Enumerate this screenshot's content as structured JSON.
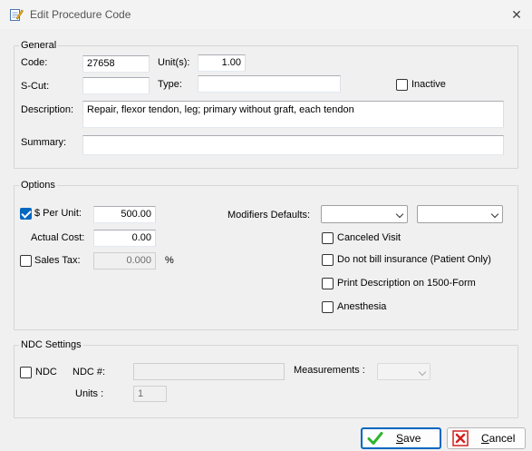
{
  "window": {
    "title": "Edit Procedure Code",
    "close_glyph": "✕",
    "icon": "edit-document-icon"
  },
  "general": {
    "legend": "General",
    "code_label": "Code:",
    "code_value": "27658",
    "units_label": "Unit(s):",
    "units_value": "1.00",
    "scut_label": "S-Cut:",
    "scut_value": "",
    "type_label": "Type:",
    "type_value": "",
    "inactive_label": "Inactive",
    "inactive_checked": false,
    "description_label": "Description:",
    "description_value": "Repair, flexor tendon, leg; primary without graft, each tendon",
    "summary_label": "Summary:",
    "summary_value": ""
  },
  "options": {
    "legend": "Options",
    "per_unit_label": "$ Per Unit:",
    "per_unit_checked": true,
    "per_unit_value": "500.00",
    "actual_cost_label": "Actual Cost:",
    "actual_cost_value": "0.00",
    "sales_tax_label": "Sales Tax:",
    "sales_tax_checked": false,
    "sales_tax_value": "0.000",
    "sales_tax_unit": "%",
    "modifiers_label": "Modifiers Defaults:",
    "modifier1_value": "",
    "modifier2_value": "",
    "canceled_visit_label": "Canceled Visit",
    "do_not_bill_label": "Do not bill insurance (Patient Only)",
    "print_desc_label": "Print Description on 1500-Form",
    "anesthesia_label": "Anesthesia"
  },
  "ndc": {
    "legend": "NDC Settings",
    "ndc_label": "NDC",
    "ndc_checked": false,
    "ndc_num_label": "NDC #:",
    "ndc_num_value": "",
    "measurements_label": "Measurements :",
    "measurements_value": "",
    "units_label": "Units :",
    "units_value": "1"
  },
  "buttons": {
    "save_label": "Save",
    "save_mnemonic": "S",
    "save_rest": "ave",
    "cancel_label": "Cancel",
    "cancel_mnemonic": "C",
    "cancel_rest": "ancel"
  },
  "colors": {
    "accent": "#0067c0",
    "save_icon": "#2db52d",
    "cancel_icon": "#d42020"
  }
}
